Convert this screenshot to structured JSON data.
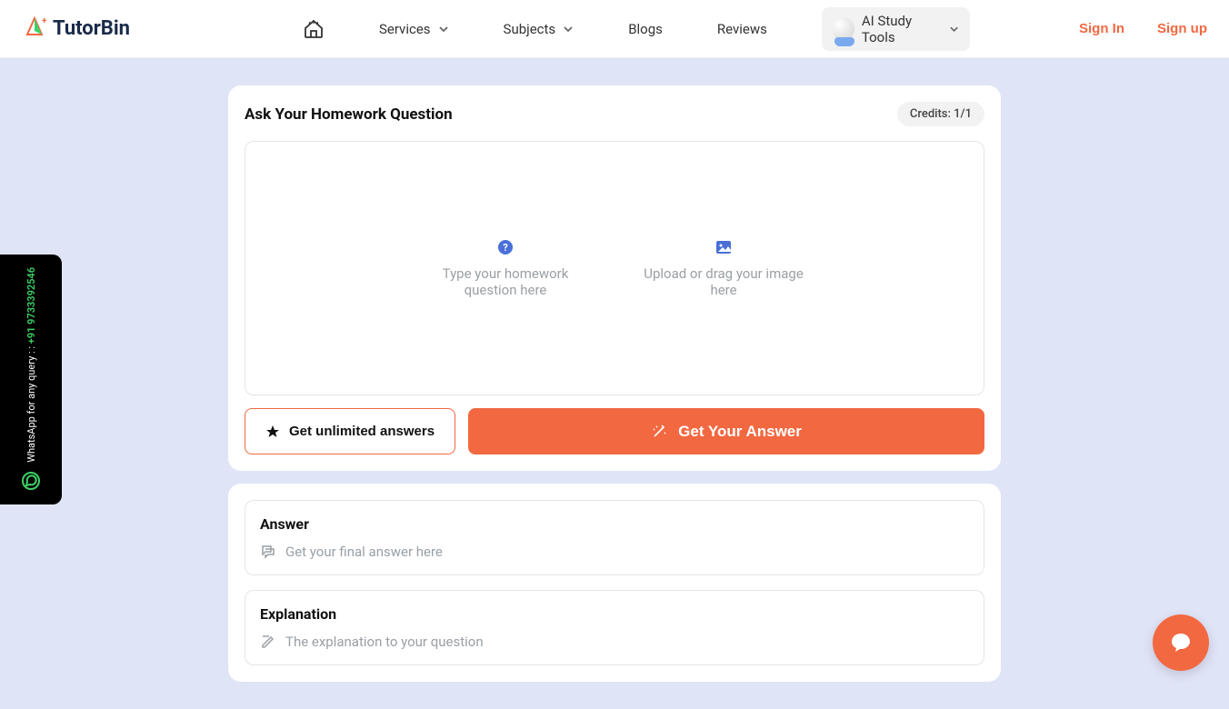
{
  "header": {
    "logo_text": "TutorBin",
    "nav": {
      "services": "Services",
      "subjects": "Subjects",
      "blogs": "Blogs",
      "reviews": "Reviews",
      "ai_tools": "AI Study Tools"
    },
    "auth": {
      "signin": "Sign In",
      "signup": "Sign up"
    }
  },
  "ask_card": {
    "title": "Ask Your Homework Question",
    "credits": "Credits: 1/1",
    "type_placeholder": "Type your homework question here",
    "upload_placeholder": "Upload or drag your image here",
    "btn_unlimited": "Get unlimited answers",
    "btn_get_answer": "Get Your Answer"
  },
  "answer_card": {
    "answer_title": "Answer",
    "answer_placeholder": "Get your final answer here",
    "explanation_title": "Explanation",
    "explanation_placeholder": "The explanation to your question"
  },
  "whatsapp": {
    "label": "WhatsApp for any query : :",
    "number": "+91 9733392546"
  },
  "colors": {
    "accent": "#f26841",
    "bg": "#e0e4f7"
  }
}
